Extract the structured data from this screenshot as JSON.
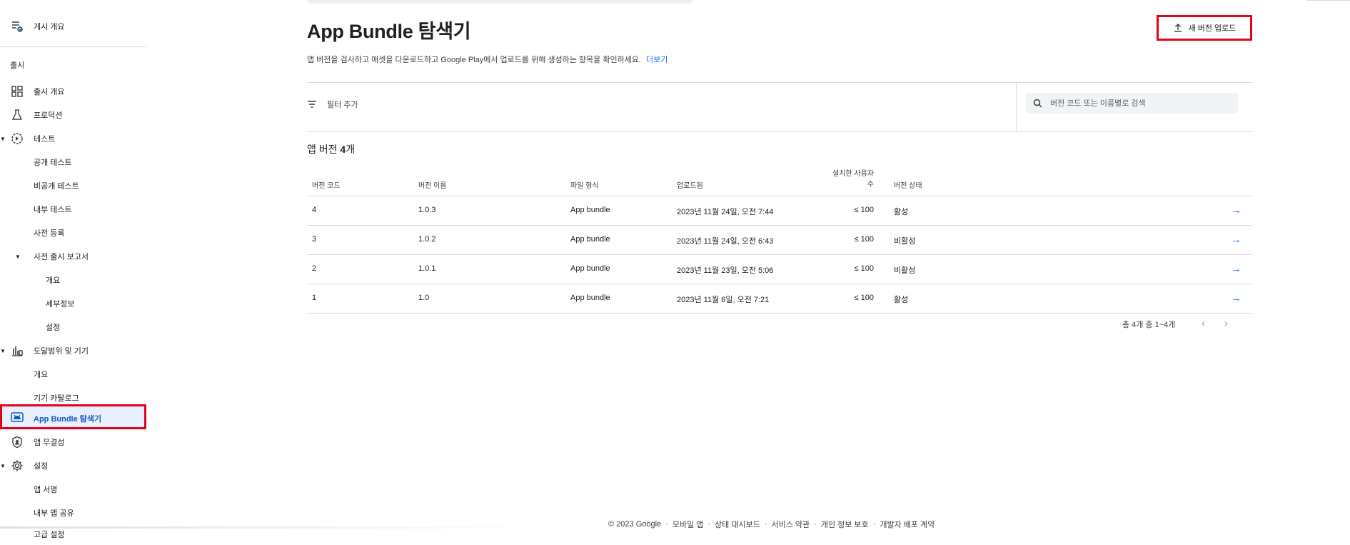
{
  "sidebar": {
    "overview": "게시 개요",
    "section_release": "출시",
    "release_overview": "출시 개요",
    "production": "프로덕션",
    "testing": "테스트",
    "open_testing": "공개 테스트",
    "closed_testing": "비공개 테스트",
    "internal_testing": "내부 테스트",
    "pre_registration": "사전 등록",
    "pre_launch_report": "사전 출시 보고서",
    "pre_launch_overview": "개요",
    "pre_launch_details": "세부정보",
    "pre_launch_settings": "설정",
    "reach_devices": "도달범위 및 기기",
    "reach_overview": "개요",
    "device_catalog": "기기 카탈로그",
    "app_bundle_explorer": "App Bundle 탐색기",
    "app_integrity": "앱 무결성",
    "setup": "설정",
    "app_signing": "앱 서명",
    "internal_app_sharing": "내부 앱 공유",
    "advanced_settings": "고급 설정"
  },
  "header": {
    "title": "App Bundle 탐색기",
    "upload_button": "새 버전 업로드",
    "description": "앱 버전을 검사하고 애셋을 다운로드하고 Google Play에서 업로드를 위해 생성하는 항목을 확인하세요.",
    "more_link": "더보기"
  },
  "filter": {
    "add_filter": "필터 추가",
    "search_placeholder": "버전 코드 또는 이름별로 검색"
  },
  "summary": {
    "prefix": "앱 버전 ",
    "count": "4",
    "suffix": "개"
  },
  "table": {
    "headers": {
      "version_code": "버전 코드",
      "version_name": "버전 이름",
      "file_type": "파일 형식",
      "uploaded": "업로드됨",
      "installs_line1": "설치한 사용자",
      "installs_line2": "수",
      "status": "버전 상태"
    },
    "rows": [
      {
        "code": "4",
        "name": "1.0.3",
        "type": "App bundle",
        "uploaded": "2023년 11월 24일, 오전 7:44",
        "installs": "≤ 100",
        "status": "활성"
      },
      {
        "code": "3",
        "name": "1.0.2",
        "type": "App bundle",
        "uploaded": "2023년 11월 24일, 오전 6:43",
        "installs": "≤ 100",
        "status": "비활성"
      },
      {
        "code": "2",
        "name": "1.0.1",
        "type": "App bundle",
        "uploaded": "2023년 11월 23일, 오전 5:06",
        "installs": "≤ 100",
        "status": "비활성"
      },
      {
        "code": "1",
        "name": "1.0",
        "type": "App bundle",
        "uploaded": "2023년 11월 6일, 오전 7:21",
        "installs": "≤ 100",
        "status": "활성"
      }
    ]
  },
  "pagination": {
    "text": "총 4개 중 1~4개"
  },
  "footer": {
    "copyright": "© 2023 Google",
    "mobile_app": "모바일 앱",
    "status_dashboard": "상태 대시보드",
    "terms": "서비스 약관",
    "privacy": "개인 정보 보호",
    "developer_agreement": "개발자 배포 계약"
  },
  "colors": {
    "accent": "#1a73e8",
    "highlight_border": "#e5001c",
    "active_bg": "#e8f0fe"
  }
}
